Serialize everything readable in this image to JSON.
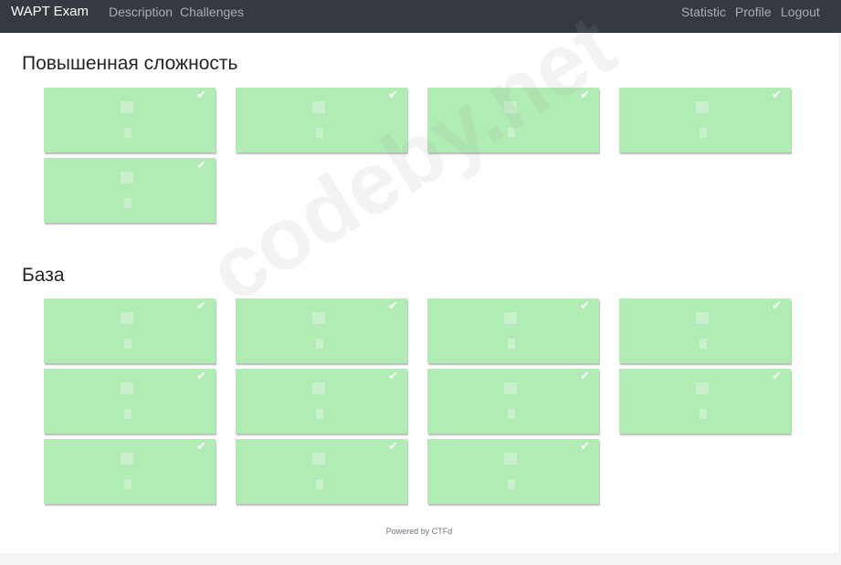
{
  "nav": {
    "brand": "WAPT Exam",
    "left_links": [
      "Description",
      "Challenges"
    ],
    "right_links": [
      "Statistic",
      "Profile",
      "Logout"
    ]
  },
  "sections": [
    {
      "title": "Повышенная сложность",
      "card_count": 5
    },
    {
      "title": "База",
      "card_count": 11
    }
  ],
  "card_check_glyph": "✔",
  "card_color": "#b0ecb4",
  "footer": "Powered by CTFd",
  "watermark": "codeby.net"
}
